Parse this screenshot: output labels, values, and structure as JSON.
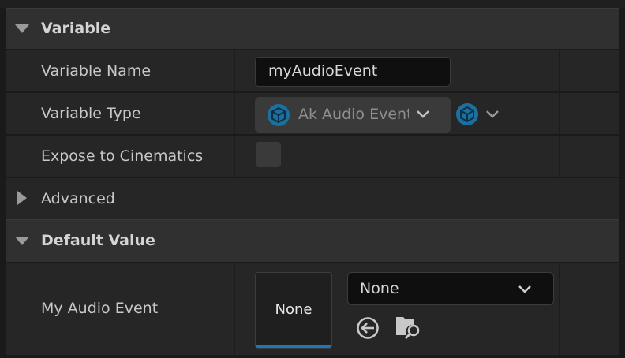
{
  "sections": {
    "variable": {
      "title": "Variable",
      "rows": {
        "name": {
          "label": "Variable Name",
          "value": "myAudioEvent"
        },
        "type": {
          "label": "Variable Type",
          "value": "Ak Audio Event",
          "icon": "cube-icon"
        },
        "expose": {
          "label": "Expose to Cinematics",
          "checked": false
        }
      }
    },
    "advanced": {
      "title": "Advanced"
    },
    "default_value": {
      "title": "Default Value",
      "row": {
        "label": "My Audio Event",
        "thumbnail_text": "None",
        "combo_value": "None"
      }
    }
  },
  "colors": {
    "accent": "#1e78b4",
    "icon_blue": "#1d6f9e",
    "panel_bg": "#262626",
    "header_bg": "#303030"
  }
}
